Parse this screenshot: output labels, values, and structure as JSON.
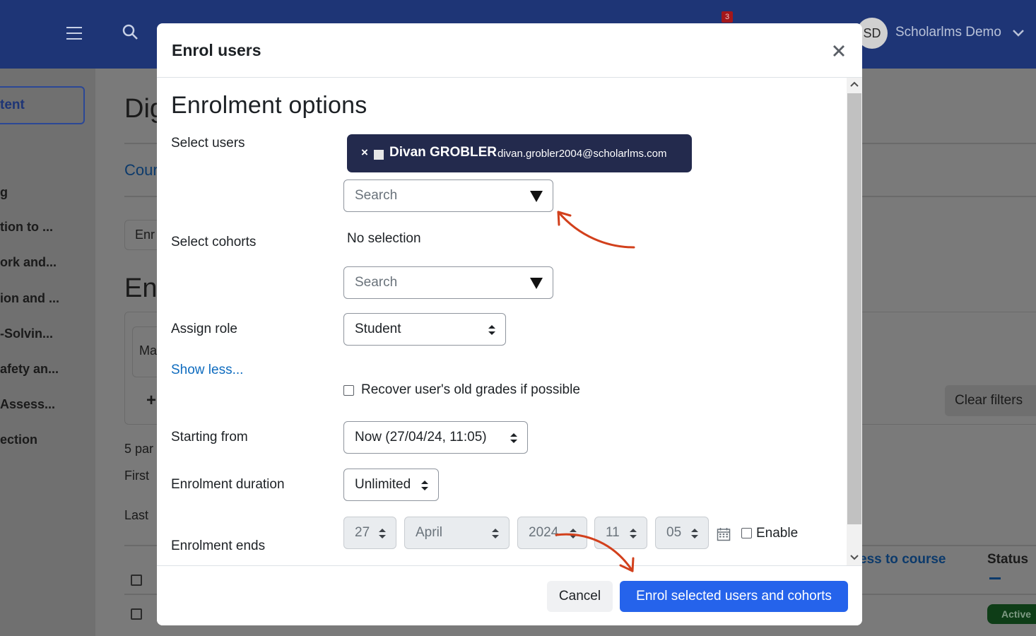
{
  "background": {
    "notification_count": "3",
    "avatar_initials": "SD",
    "user_name": "Scholarlms Demo",
    "sidebar_button_label": "tent",
    "sidebar_items": [
      "g",
      "tion to ...",
      "ork and...",
      "ion and ...",
      "-Solvin...",
      "afety an...",
      "Assess...",
      "ection"
    ],
    "page_title_fragment": "Dig",
    "course_tab_fragment": "Cour",
    "enrol_button_fragment": "Enr",
    "section_heading_fragment": "En",
    "filter_fragment": "Ma",
    "participants_fragment": "5 par",
    "first_fragment": "First",
    "last_fragment": "Last",
    "clear_filters": "Clear filters",
    "access_column": "ess to course",
    "status_column": "Status",
    "active_badge": "Active"
  },
  "modal": {
    "title": "Enrol users",
    "heading": "Enrolment options",
    "select_users": {
      "label": "Select users",
      "selected_name": "Divan GROBLER",
      "selected_email": "divan.grobler2004@scholarlms.com",
      "search_placeholder": "Search"
    },
    "select_cohorts": {
      "label": "Select cohorts",
      "no_selection": "No selection",
      "search_placeholder": "Search"
    },
    "assign_role": {
      "label": "Assign role",
      "value": "Student"
    },
    "show_less": "Show less...",
    "recover_grades": {
      "label": "Recover user's old grades if possible",
      "checked": false
    },
    "starting_from": {
      "label": "Starting from",
      "value": "Now (27/04/24, 11:05)"
    },
    "enrolment_duration": {
      "label": "Enrolment duration",
      "value": "Unlimited"
    },
    "enrolment_ends": {
      "label": "Enrolment ends",
      "day": "27",
      "month": "April",
      "year": "2024",
      "hour": "11",
      "minute": "05",
      "enable_label": "Enable",
      "enabled": false
    },
    "cancel_label": "Cancel",
    "submit_label": "Enrol selected users and cohorts"
  },
  "colors": {
    "topbar": "#1e3576",
    "primary_button": "#2563eb",
    "chip": "#232a4d",
    "link": "#0f6cbf",
    "annotation_arrow": "#d2401c"
  }
}
